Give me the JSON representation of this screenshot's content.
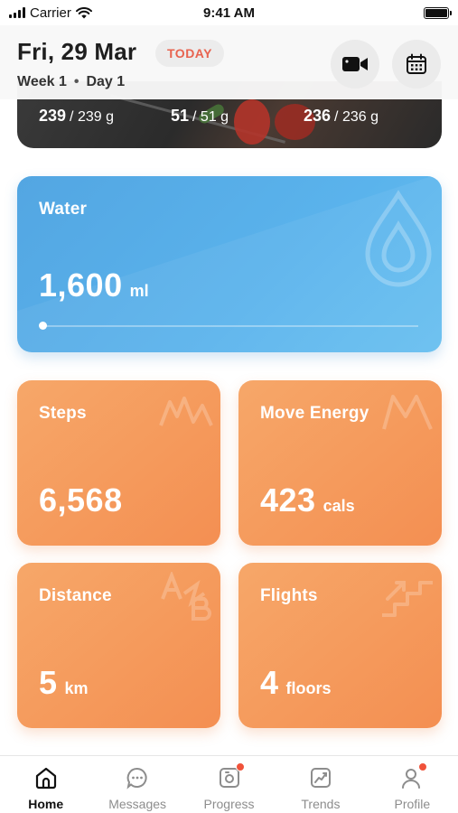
{
  "status_bar": {
    "carrier": "Carrier",
    "time": "9:41 AM"
  },
  "header": {
    "date": "Fri, 29 Mar",
    "today_badge": "TODAY",
    "week": "Week 1",
    "separator": "•",
    "day": "Day 1",
    "buttons": [
      {
        "name": "video",
        "icon": "video-camera-icon"
      },
      {
        "name": "calendar",
        "icon": "calendar-icon"
      }
    ]
  },
  "meal_macros": [
    {
      "value": "239",
      "total": "/ 239 g"
    },
    {
      "value": "51",
      "total": "/ 51 g"
    },
    {
      "value": "236",
      "total": "/ 236 g"
    }
  ],
  "water": {
    "title": "Water",
    "value": "1,600",
    "unit": "ml",
    "progress": 0.0,
    "icon": "water-drop-icon",
    "color": "#53a6e2"
  },
  "metrics": [
    {
      "id": "steps",
      "title": "Steps",
      "value": "6,568",
      "unit": "",
      "icon": "steps-icon"
    },
    {
      "id": "move",
      "title": "Move Energy",
      "value": "423",
      "unit": "cals",
      "icon": "energy-icon"
    },
    {
      "id": "distance",
      "title": "Distance",
      "value": "5",
      "unit": "km",
      "icon": "a-to-b-icon"
    },
    {
      "id": "flights",
      "title": "Flights",
      "value": "4",
      "unit": "floors",
      "icon": "stairs-icon"
    }
  ],
  "accent_orange": "#f59a5c",
  "tabs": [
    {
      "label": "Home",
      "icon": "home-icon",
      "active": true,
      "badge": false
    },
    {
      "label": "Messages",
      "icon": "chat-icon",
      "active": false,
      "badge": false
    },
    {
      "label": "Progress",
      "icon": "camera-progress-icon",
      "active": false,
      "badge": true
    },
    {
      "label": "Trends",
      "icon": "trend-chart-icon",
      "active": false,
      "badge": false
    },
    {
      "label": "Profile",
      "icon": "profile-icon",
      "active": false,
      "badge": true
    }
  ]
}
